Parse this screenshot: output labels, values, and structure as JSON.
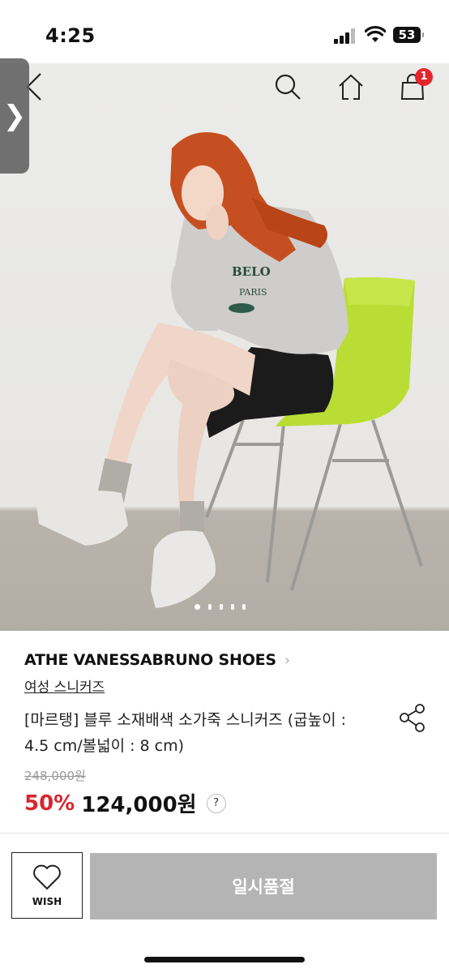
{
  "status_bar": {
    "time": "4:25",
    "battery": "53"
  },
  "nav": {
    "cart_badge": "1"
  },
  "side_tab": {
    "label": "❯"
  },
  "gallery": {
    "total_images": 5,
    "current_index": 1
  },
  "product": {
    "brand": "ATHE VANESSABRUNO SHOES",
    "brand_chevron": "›",
    "category": "여성 스니커즈",
    "title": "[마르탱] 블루 소재배색 소가죽 스니커즈 (굽높이 : 4.5 cm/볼넓이 : 8 cm)",
    "original_price": "248,000원",
    "discount": "50%",
    "price": "124,000원",
    "help_label": "?"
  },
  "actions": {
    "wish_label": "WISH",
    "soldout_label": "일시품절"
  },
  "icons": [
    "back-icon",
    "search-icon",
    "home-icon",
    "cart-icon",
    "share-icon",
    "heart-icon"
  ],
  "colors": {
    "accent_red": "#d8262e",
    "badge_red": "#e4252c",
    "soldout_gray": "#b4b4b4",
    "chair_green": "#b9dd34"
  }
}
